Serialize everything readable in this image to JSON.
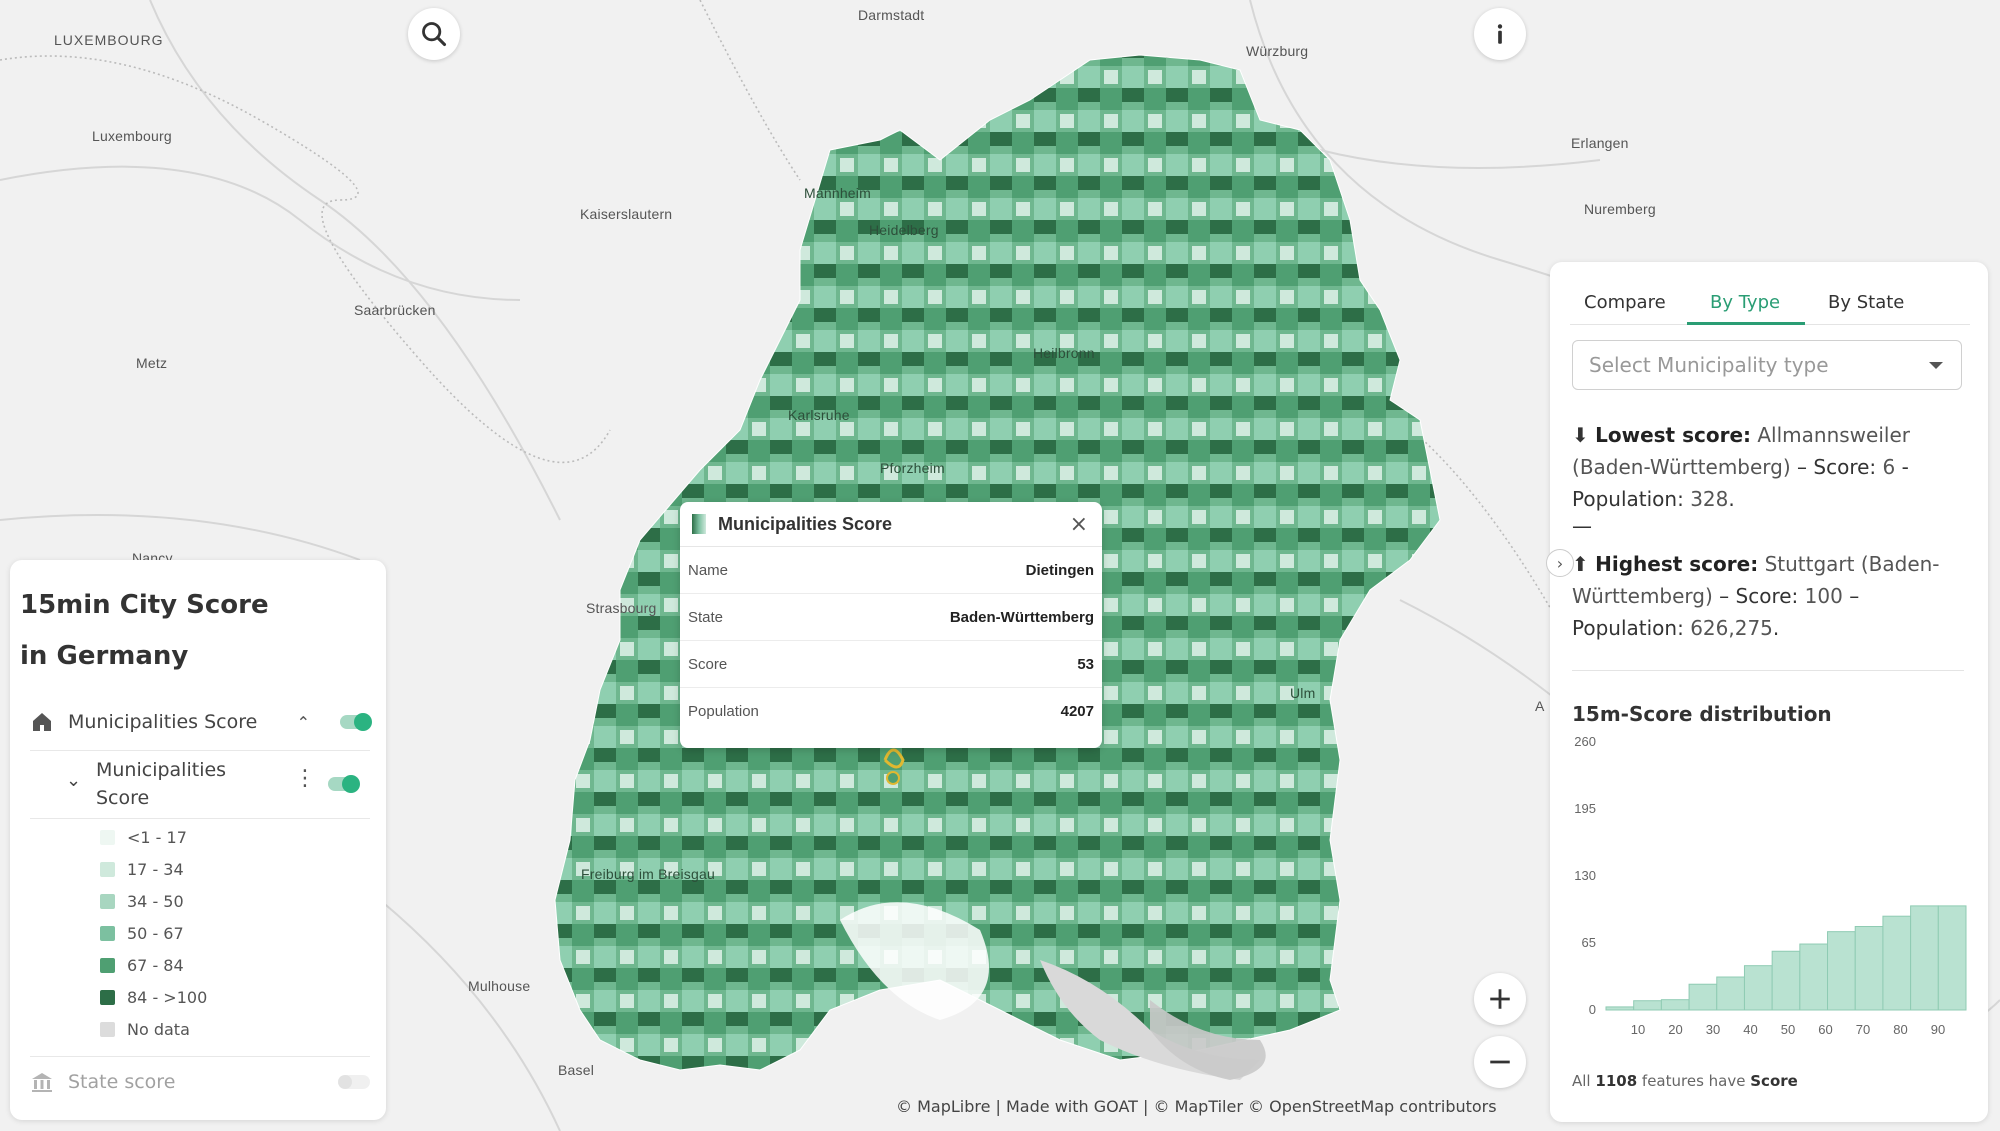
{
  "map_labels": {
    "luxembourg_country": "LUXEMBOURG",
    "luxembourg_city": "Luxembourg",
    "darmstadt": "Darmstadt",
    "wurzburg": "Würzburg",
    "erlangen": "Erlangen",
    "nuremberg": "Nuremberg",
    "kaiserslautern": "Kaiserslautern",
    "saarbrucken": "Saarbrücken",
    "metz": "Metz",
    "mannheim": "Mannheim",
    "heidelberg": "Heidelberg",
    "heilbronn": "Heilbronn",
    "karlsruhe": "Karlsruhe",
    "pforzheim": "Pforzheim",
    "nancy": "Nancy",
    "strasbourg": "Strasbourg",
    "ulm": "Ulm",
    "freiburg": "Freiburg im Breisgau",
    "mulhouse": "Mulhouse",
    "basel": "Basel",
    "a_label": "A"
  },
  "left_panel": {
    "title_line1": "15min City Score",
    "title_line2": "in Germany",
    "layer_group": "Municipalities Score",
    "layer_name_line1": "Municipalities",
    "layer_name_line2": "Score",
    "legend": [
      {
        "label": "<1 - 17",
        "color": "#eef7f2"
      },
      {
        "label": "17 - 34",
        "color": "#cfe9dc"
      },
      {
        "label": "34 - 50",
        "color": "#a8d6c0"
      },
      {
        "label": "50 - 67",
        "color": "#7cc0a0"
      },
      {
        "label": "67 - 84",
        "color": "#4f9f72"
      },
      {
        "label": "84 - >100",
        "color": "#2d6e47"
      },
      {
        "label": "No data",
        "color": "#dcdcdc"
      }
    ],
    "state_score": "State score"
  },
  "popup": {
    "title": "Municipalities Score",
    "rows": [
      {
        "label": "Name",
        "value": "Dietingen"
      },
      {
        "label": "State",
        "value": "Baden-Württemberg"
      },
      {
        "label": "Score",
        "value": "53"
      },
      {
        "label": "Population",
        "value": "4207"
      }
    ]
  },
  "right_panel": {
    "tabs": [
      "Compare",
      "By Type",
      "By State"
    ],
    "active_tab": "By Type",
    "select_placeholder": "Select Municipality type",
    "lowest_label": "Lowest score:",
    "lowest_name": "Allmannsweiler",
    "lowest_state": "Baden-Württemberg",
    "lowest_score_label": "– Score:",
    "lowest_score": "6",
    "lowest_pop_label": "Population:",
    "lowest_pop": "328",
    "separator": "—",
    "highest_label": "Highest score:",
    "highest_name": "Stuttgart",
    "highest_state": "Baden-Württemberg",
    "highest_score_label": "– Score:",
    "highest_score": "100",
    "highest_pop_label": "Population:",
    "highest_pop": "626,275",
    "dist_title": "15m-Score distribution",
    "footer_prefix": "All",
    "footer_count": "1108",
    "footer_mid": "features have",
    "footer_field": "Score"
  },
  "chart_data": {
    "type": "bar",
    "x_ticks": [
      "10",
      "20",
      "30",
      "40",
      "50",
      "60",
      "70",
      "80",
      "90"
    ],
    "values": [
      3,
      9,
      10,
      25,
      32,
      43,
      57,
      64,
      76,
      81,
      91,
      101,
      101
    ],
    "bins_note": "",
    "ylim": [
      0,
      260
    ],
    "y_ticks": [
      "0",
      "65",
      "130",
      "195",
      "260"
    ],
    "bar_color": "#b9e2d1",
    "bar_edge": "#8fcbb3"
  },
  "attribution": "© MapLibre | Made with GOAT | © MapTiler © OpenStreetMap contributors",
  "colors": {
    "accent": "#2bb381",
    "tab_active": "#2a9d74"
  }
}
